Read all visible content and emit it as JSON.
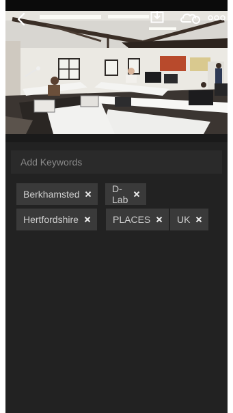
{
  "toolbar": {
    "back_icon": "chevron-left-icon",
    "share_icon": "share-export-icon",
    "cloud_icon": "cloud-sync-icon",
    "more_icon": "more-dots-icon"
  },
  "photo": {
    "subject": "office-interior-photo"
  },
  "keywords": {
    "placeholder": "Add Keywords",
    "tags": [
      {
        "label": "Berkhamsted"
      },
      {
        "label": "D-Lab"
      },
      {
        "label": "Hertfordshire"
      },
      {
        "label": "PLACES"
      },
      {
        "label": "UK"
      }
    ]
  },
  "colors": {
    "background": "#222222",
    "tag_background": "#3a3a3a",
    "text": "#cfcfcf"
  }
}
